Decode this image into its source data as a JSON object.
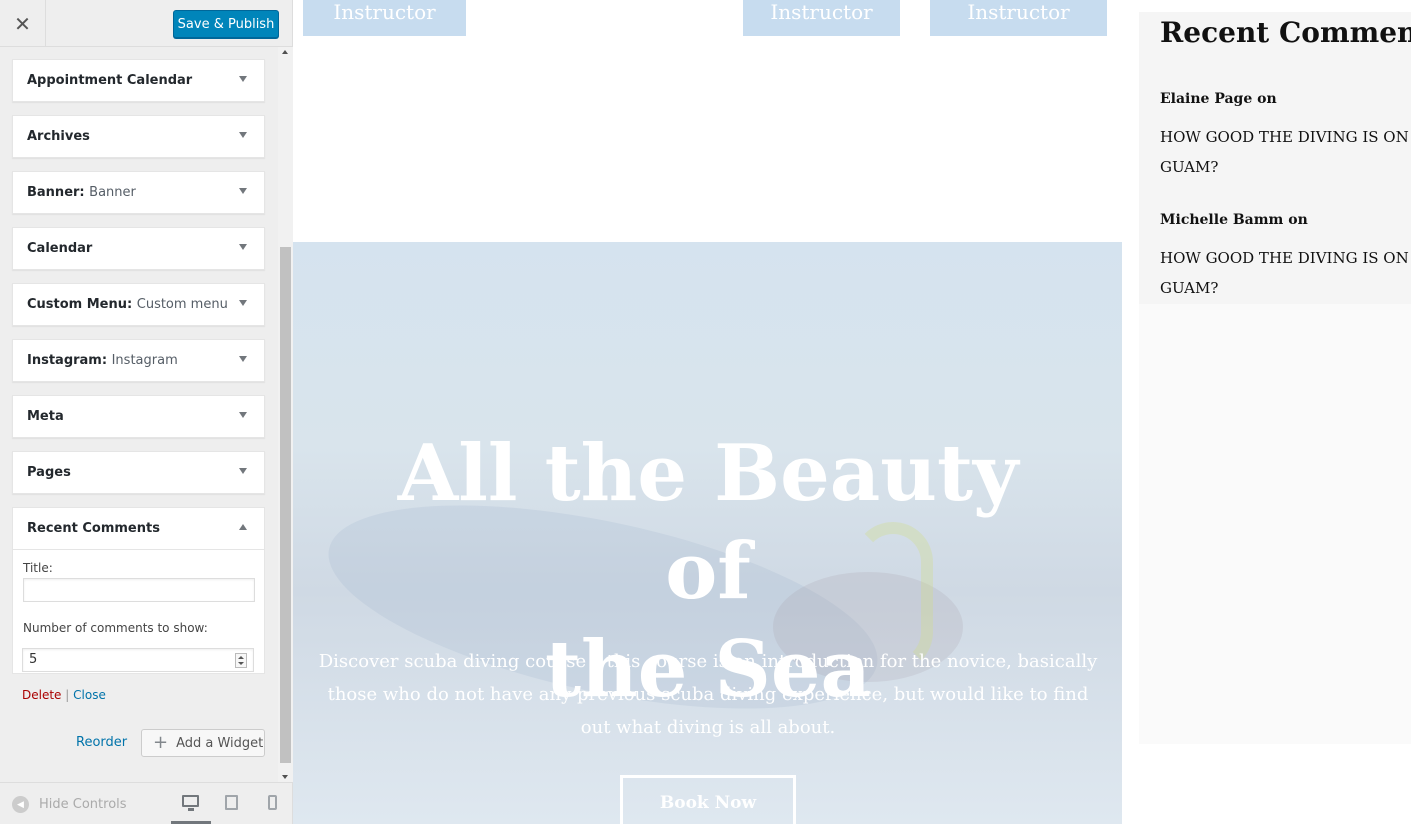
{
  "header": {
    "close_glyph": "✕",
    "save_label": "Save & Publish"
  },
  "widgets": [
    {
      "title": "Appointment Calendar",
      "subtitle": ""
    },
    {
      "title": "Archives",
      "subtitle": ""
    },
    {
      "title": "Banner:",
      "subtitle": "Banner"
    },
    {
      "title": "Calendar",
      "subtitle": ""
    },
    {
      "title": "Custom Menu:",
      "subtitle": "Custom menu"
    },
    {
      "title": "Instagram:",
      "subtitle": "Instagram"
    },
    {
      "title": "Meta",
      "subtitle": ""
    },
    {
      "title": "Pages",
      "subtitle": ""
    }
  ],
  "recent_comments_widget": {
    "title": "Recent Comments",
    "title_label": "Title:",
    "title_value": "",
    "number_label": "Number of comments to show:",
    "number_value": "5",
    "delete_label": "Delete",
    "separator": "|",
    "close_label": "Close"
  },
  "actions": {
    "reorder_label": "Reorder",
    "add_widget_label": "Add a Widget"
  },
  "footer": {
    "hide_controls_label": "Hide Controls"
  },
  "preview": {
    "instructor_label": "Instructor",
    "hero_title_line1": "All the Beauty of",
    "hero_title_line2": "the Sea",
    "hero_text": "Discover scuba diving course – this course is an introduction for the novice, basically those who do not have any previous scuba diving experience, but would like to find out what diving is all about.",
    "book_now_label": "Book Now",
    "recent_comments": {
      "heading": "Recent Comments",
      "items": [
        {
          "author": "Elaine Page",
          "on": "on",
          "post": "HOW GOOD THE DIVING IS ON GUAM?"
        },
        {
          "author": "Michelle Bamm",
          "on": "on",
          "post": "HOW GOOD THE DIVING IS ON GUAM?"
        }
      ]
    }
  },
  "colors": {
    "primary_button": "#0085ba",
    "link": "#0073aa",
    "delete": "#aa0000",
    "instructor_bg": "#c7dcef"
  },
  "icons": [
    "close-icon",
    "caret-down-icon",
    "caret-up-icon",
    "plus-icon",
    "hide-controls-icon",
    "desktop-icon",
    "tablet-icon",
    "mobile-icon"
  ]
}
